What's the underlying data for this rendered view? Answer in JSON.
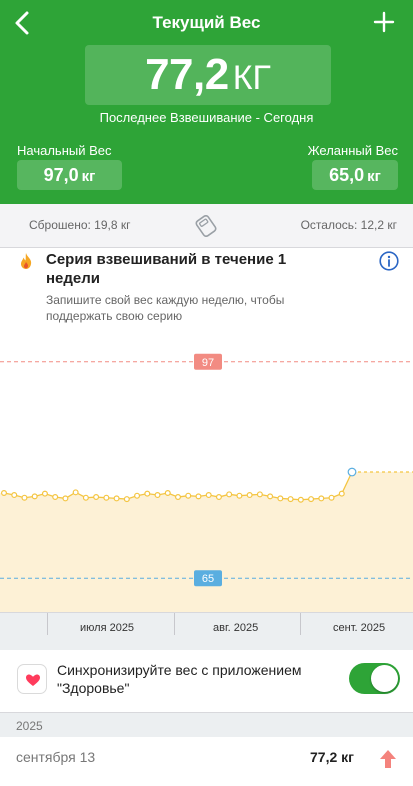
{
  "nav": {
    "title": "Текущий Вес",
    "back_icon": "chevron-left-icon",
    "add_icon": "plus-icon"
  },
  "current": {
    "value": "77,2",
    "unit": "КГ",
    "subtitle": "Последнее Взвешивание - Сегодня"
  },
  "start": {
    "label": "Начальный Вес",
    "value": "97,0",
    "unit": "кг"
  },
  "goal": {
    "label": "Желанный Вес",
    "value": "65,0",
    "unit": "кг"
  },
  "stats": {
    "lost": "Сброшено: 19,8 кг",
    "remaining": "Осталось: 12,2 кг",
    "icon": "scale-icon"
  },
  "streak": {
    "title": "Серия взвешиваний в течение 1 недели",
    "description": "Запишите свой вес каждую неделю, чтобы поддержать свою серию",
    "icon": "flame-icon",
    "info_icon": "info-icon"
  },
  "chart_data": {
    "type": "line",
    "start_line": 97,
    "goal_line": 65,
    "ylim": [
      60,
      102
    ],
    "x_tick_labels": [
      "июля 2025",
      "авг. 2025",
      "сент. 2025"
    ],
    "values": [
      77.6,
      77.3,
      76.9,
      77.1,
      77.5,
      77.0,
      76.8,
      77.7,
      76.9,
      77.0,
      76.9,
      76.8,
      76.7,
      77.2,
      77.5,
      77.3,
      77.6,
      77.0,
      77.2,
      77.1,
      77.3,
      77.0,
      77.4,
      77.2,
      77.3,
      77.4,
      77.1,
      76.8,
      76.7,
      76.6,
      76.7,
      76.8,
      76.9,
      77.5,
      80.7
    ],
    "colors": {
      "line": "#f4c542",
      "fill": "#fdf1d6",
      "start": "#f28b82",
      "goal": "#5aaee0"
    }
  },
  "health": {
    "text": "Синхронизируйте вес с приложением \"Здоровье\"",
    "icon": "heart-icon",
    "toggle_on": true
  },
  "history": {
    "year": "2025",
    "entries": [
      {
        "date": "сентября 13",
        "weight": "77,2 кг",
        "icon": "arrow-up-icon"
      }
    ]
  },
  "colors": {
    "brand": "#2ea437",
    "increase": "#f4837d"
  }
}
